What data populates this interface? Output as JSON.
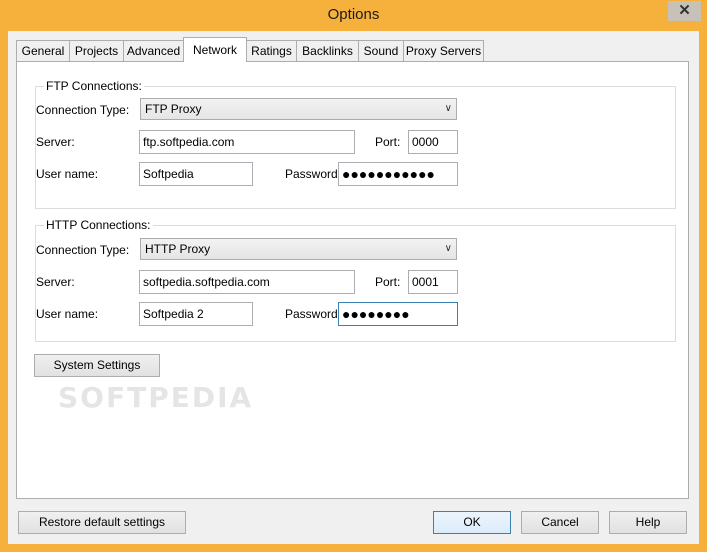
{
  "window": {
    "title": "Options",
    "close_glyph": "✕"
  },
  "tabs": [
    "General",
    "Projects",
    "Advanced",
    "Network",
    "Ratings",
    "Backlinks",
    "Sound",
    "Proxy Servers"
  ],
  "active_tab": "Network",
  "ftp": {
    "legend": "FTP Connections:",
    "connection_type_label": "Connection Type:",
    "connection_type_value": "FTP Proxy",
    "server_label": "Server:",
    "server_value": "ftp.softpedia.com",
    "port_label": "Port:",
    "port_value": "0000",
    "user_label": "User name:",
    "user_value": "Softpedia",
    "password_label": "Password:",
    "password_value": "●●●●●●●●●●●"
  },
  "http": {
    "legend": "HTTP Connections:",
    "connection_type_label": "Connection Type:",
    "connection_type_value": "HTTP Proxy",
    "server_label": "Server:",
    "server_value": "softpedia.softpedia.com",
    "port_label": "Port:",
    "port_value": "0001",
    "user_label": "User name:",
    "user_value": "Softpedia 2",
    "password_label": "Password:",
    "password_value": "●●●●●●●●"
  },
  "system_settings_label": "System Settings",
  "watermark": "SOFTPEDIA",
  "footer": {
    "restore_label": "Restore default settings",
    "ok_label": "OK",
    "cancel_label": "Cancel",
    "help_label": "Help"
  },
  "colors": {
    "titlebar": "#f6b13c",
    "face": "#f0f0f0",
    "focus_border": "#3c7fb1"
  }
}
